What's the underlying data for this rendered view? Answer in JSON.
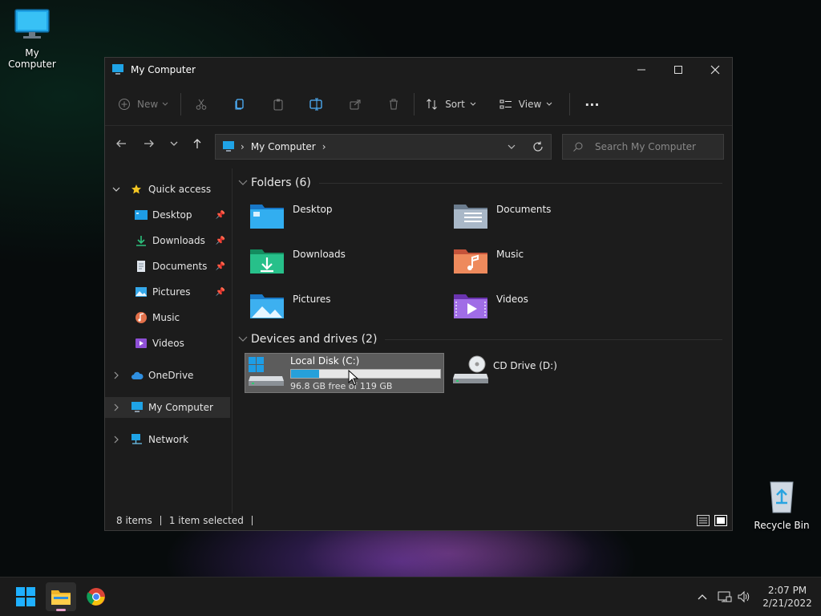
{
  "desktop": {
    "my_computer_label": "My Computer",
    "recycle_bin_label": "Recycle Bin"
  },
  "window": {
    "title": "My Computer",
    "toolbar": {
      "new_label": "New",
      "sort_label": "Sort",
      "view_label": "View",
      "more_label": "···"
    },
    "address": {
      "sep": "›",
      "crumb": "My Computer",
      "crumb_chevron": "›"
    },
    "search": {
      "placeholder": "Search My Computer"
    },
    "sidebar": {
      "quick_access": "Quick access",
      "items": [
        {
          "label": "Desktop",
          "pinned": true
        },
        {
          "label": "Downloads",
          "pinned": true
        },
        {
          "label": "Documents",
          "pinned": true
        },
        {
          "label": "Pictures",
          "pinned": true
        },
        {
          "label": "Music",
          "pinned": false
        },
        {
          "label": "Videos",
          "pinned": false
        }
      ],
      "onedrive": "OneDrive",
      "my_computer": "My Computer",
      "network": "Network"
    },
    "folders": {
      "header": "Folders (6)",
      "items": [
        {
          "label": "Desktop",
          "color": "#1e9de6"
        },
        {
          "label": "Documents",
          "color": "#8a9bb0"
        },
        {
          "label": "Downloads",
          "color": "#20b07a"
        },
        {
          "label": "Music",
          "color": "#e2704a"
        },
        {
          "label": "Pictures",
          "color": "#2a9fe6"
        },
        {
          "label": "Videos",
          "color": "#8e4fd6"
        }
      ]
    },
    "drives": {
      "header": "Devices and drives (2)",
      "c": {
        "label": "Local Disk (C:)",
        "info": "96.8 GB free of 119 GB",
        "used_fraction": 0.19
      },
      "d": {
        "label": "CD Drive (D:)"
      }
    },
    "status": {
      "items": "8 items",
      "selected": "1 item selected"
    }
  },
  "taskbar": {
    "time": "2:07 PM",
    "date": "2/21/2022"
  },
  "colors": {
    "accent": "#26a0da",
    "window_bg": "#1c1c1c"
  }
}
